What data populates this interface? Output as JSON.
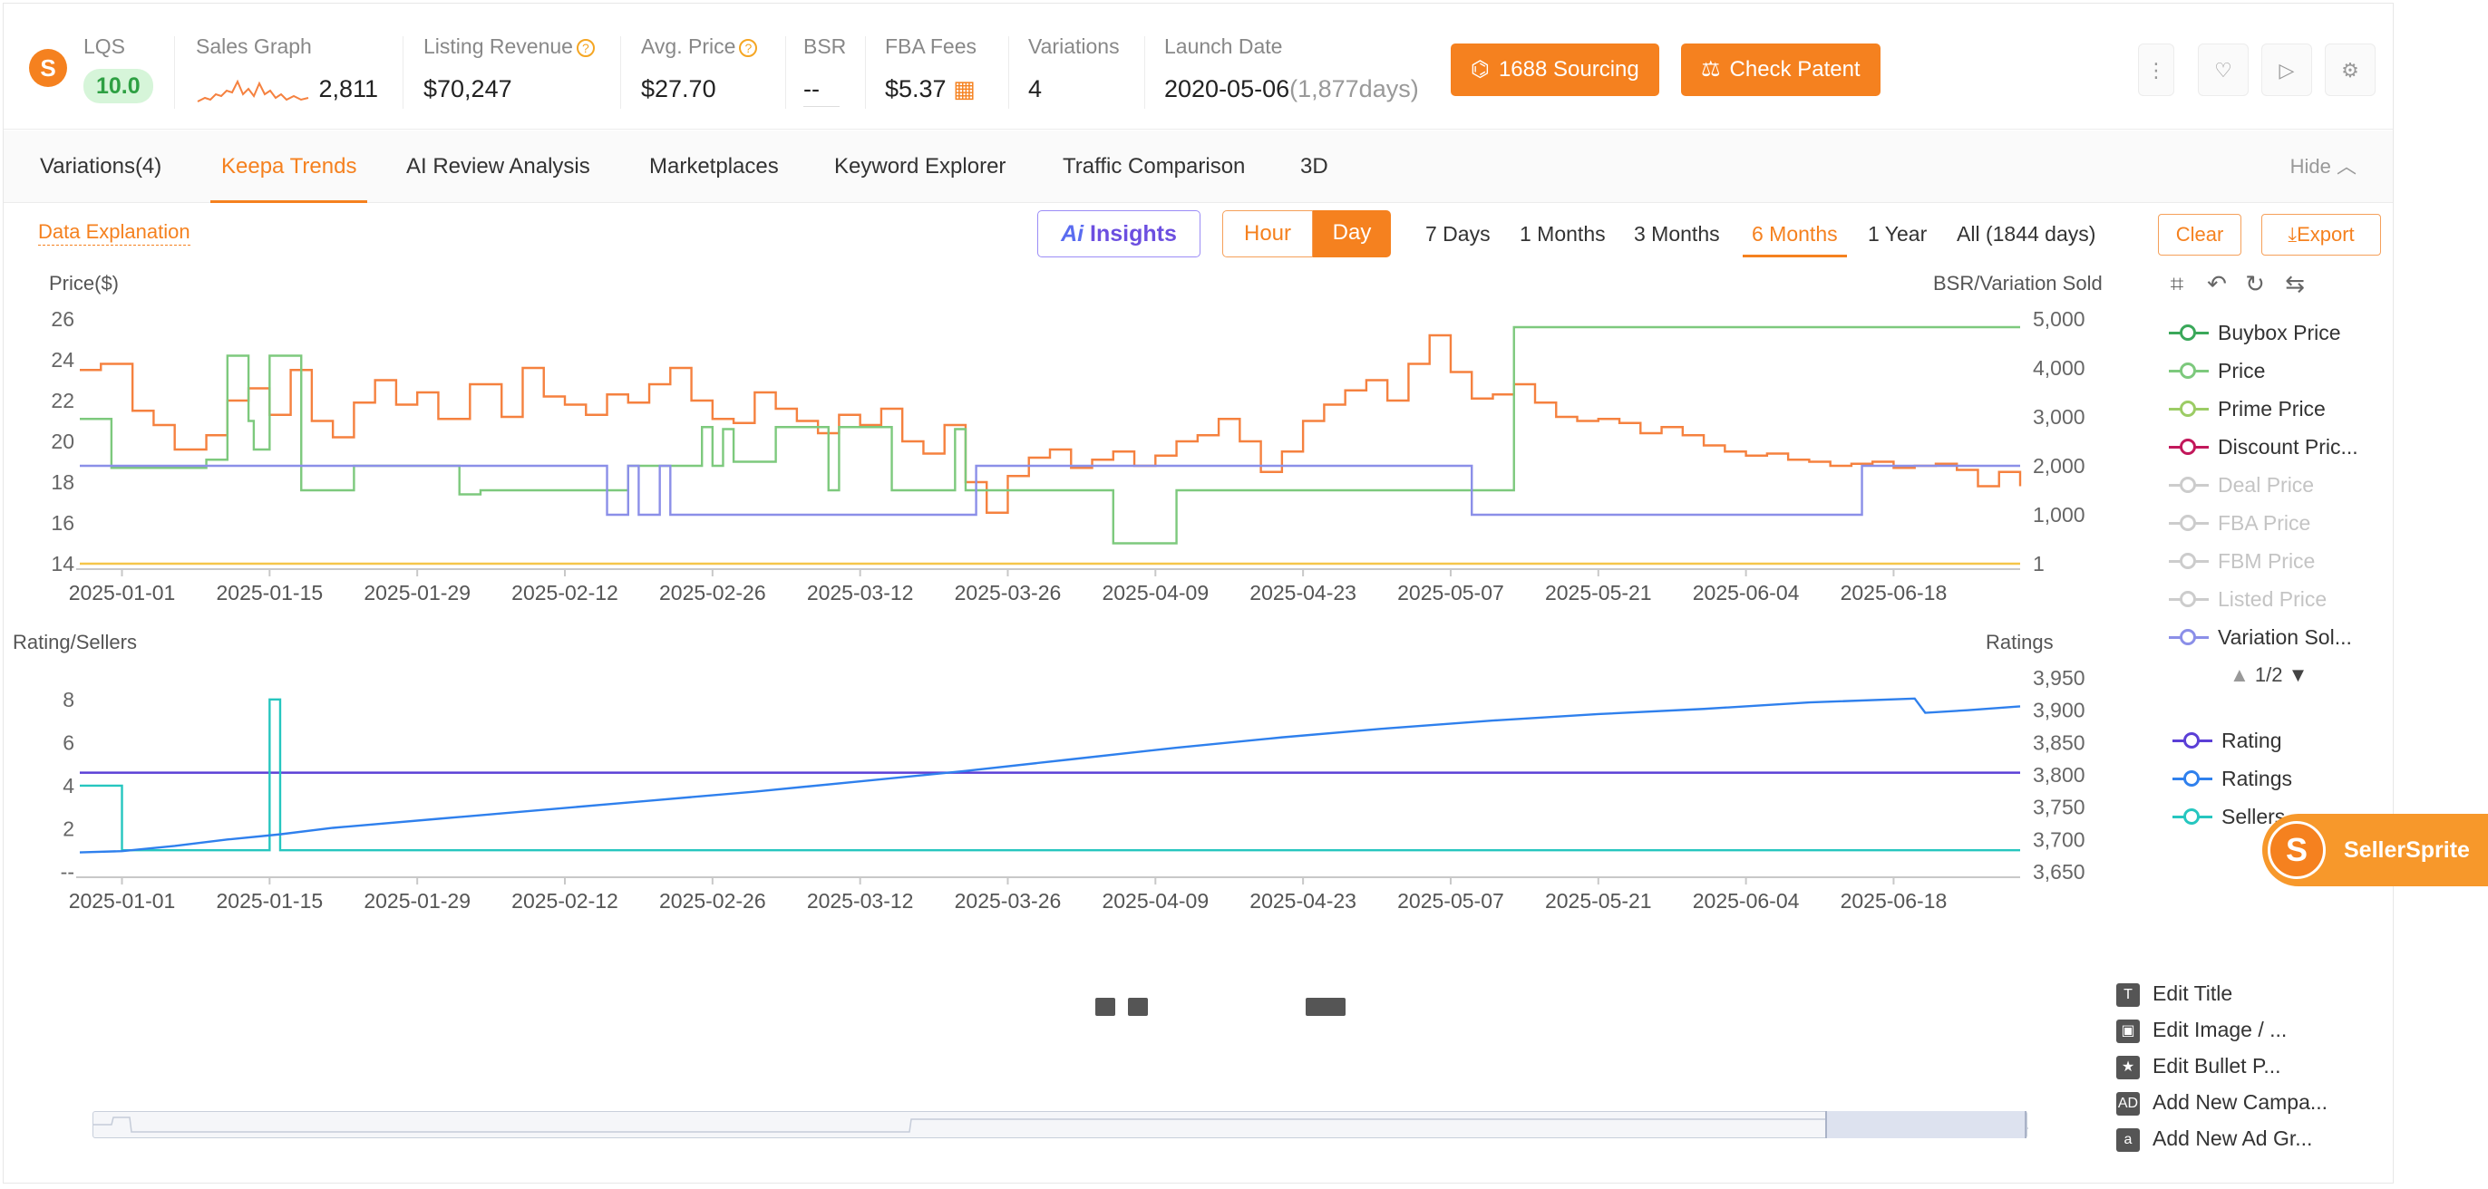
{
  "header": {
    "stats": [
      {
        "label": "LQS",
        "value": "10.0"
      },
      {
        "label": "Sales Graph",
        "value": "2,811"
      },
      {
        "label": "Listing Revenue",
        "value": "$70,247"
      },
      {
        "label": "Avg. Price",
        "value": "$27.70"
      },
      {
        "label": "BSR",
        "value": "--"
      },
      {
        "label": "FBA Fees",
        "value": "$5.37"
      },
      {
        "label": "Variations",
        "value": "4"
      },
      {
        "label": "Launch Date",
        "value": "2020-05-06",
        "extra": "(1,877days)"
      }
    ],
    "sourcing_label": "1688 Sourcing",
    "patent_label": "Check Patent",
    "icons": [
      "more-icon",
      "heart-icon",
      "video-icon",
      "settings-icon"
    ]
  },
  "tabs": [
    "Variations(4)",
    "Keepa Trends",
    "AI Review Analysis",
    "Marketplaces",
    "Keyword Explorer",
    "Traffic Comparison",
    "3D"
  ],
  "active_tab": "Keepa Trends",
  "hide_label": "Hide",
  "toolbar": {
    "data_explanation": "Data Explanation",
    "ai_insights": "Insights",
    "ai_prefix": "Ai",
    "hour": "Hour",
    "day": "Day",
    "ranges": [
      "7 Days",
      "1 Months",
      "3 Months",
      "6 Months",
      "1 Year",
      "All (1844 days)"
    ],
    "active_range": "6 Months",
    "clear": "Clear",
    "export": "Export"
  },
  "legend_top": [
    {
      "name": "Buybox Price",
      "color": "#3aa85a",
      "enabled": true
    },
    {
      "name": "Price",
      "color": "#7dc97d",
      "enabled": true
    },
    {
      "name": "Prime Price",
      "color": "#9ccc65",
      "enabled": true
    },
    {
      "name": "Discount Pric...",
      "color": "#c2185b",
      "enabled": true
    },
    {
      "name": "Deal Price",
      "color": "#cccccc",
      "enabled": false
    },
    {
      "name": "FBA Price",
      "color": "#cccccc",
      "enabled": false
    },
    {
      "name": "FBM Price",
      "color": "#cccccc",
      "enabled": false
    },
    {
      "name": "Listed Price",
      "color": "#cccccc",
      "enabled": false
    },
    {
      "name": "Variation Sol...",
      "color": "#8b8fe8",
      "enabled": true
    }
  ],
  "legend_pager": "1/2",
  "legend_bottom": [
    {
      "name": "Rating",
      "color": "#5b3fd6"
    },
    {
      "name": "Ratings",
      "color": "#2f80ed"
    },
    {
      "name": "Sellers",
      "color": "#26c6bf"
    }
  ],
  "actions": [
    "Edit Title",
    "Edit Image / ...",
    "Edit Bullet P...",
    "Add New Campa...",
    "Add New Ad Gr..."
  ],
  "brand": "SellerSprite",
  "chart_data": [
    {
      "type": "line",
      "ylabel": "Price($)",
      "y2label": "BSR/Variation Sold",
      "yticks": [
        14,
        16,
        18,
        20,
        22,
        24,
        26
      ],
      "y2ticks": [
        "1",
        "1,000",
        "2,000",
        "3,000",
        "4,000",
        "5,000"
      ],
      "xticks": [
        "2025-01-01",
        "2025-01-15",
        "2025-01-29",
        "2025-02-12",
        "2025-02-26",
        "2025-03-12",
        "2025-03-26",
        "2025-04-09",
        "2025-04-23",
        "2025-05-07",
        "2025-05-21",
        "2025-06-04",
        "2025-06-18"
      ],
      "ylim": [
        14,
        26
      ],
      "y2lim": [
        1,
        5000
      ],
      "series": [
        {
          "name": "Buybox Price",
          "color": "#f5813f",
          "axis": "left",
          "x": [
            -4,
            -2,
            1,
            3,
            5,
            8,
            10,
            12,
            14,
            16,
            18,
            20,
            22,
            24,
            26,
            28,
            30,
            33,
            36,
            38,
            40,
            42,
            44,
            46,
            48,
            50,
            52,
            54,
            56,
            58,
            60,
            62,
            64,
            66,
            68,
            70,
            72,
            74,
            76,
            78,
            80,
            82,
            84,
            86,
            88,
            90,
            92,
            94,
            96,
            98,
            100,
            102,
            104,
            106,
            108,
            110,
            112,
            114,
            116,
            118,
            120,
            122,
            124,
            126,
            128,
            130,
            132,
            134,
            136,
            138,
            140,
            142,
            144,
            146,
            148,
            150,
            152,
            154,
            156,
            158,
            160,
            162,
            164,
            166,
            168,
            170,
            172,
            174,
            176,
            178,
            180
          ],
          "y": [
            23.5,
            23.8,
            21.5,
            20.8,
            19.6,
            20.3,
            22.0,
            22.6,
            21.3,
            23.5,
            21.0,
            20.2,
            21.9,
            23.0,
            21.8,
            22.4,
            21.1,
            22.8,
            21.2,
            23.6,
            22.2,
            21.8,
            21.3,
            22.3,
            21.9,
            22.8,
            23.6,
            22.0,
            21.1,
            20.9,
            22.4,
            21.6,
            21.0,
            20.4,
            21.3,
            20.8,
            21.6,
            20.0,
            19.4,
            20.8,
            18.0,
            16.5,
            18.3,
            19.2,
            19.6,
            18.7,
            19.1,
            19.5,
            18.8,
            19.3,
            20.0,
            20.3,
            21.1,
            20.0,
            18.5,
            19.5,
            21.0,
            21.8,
            22.5,
            23.0,
            22.0,
            23.8,
            25.2,
            23.4,
            22.1,
            22.3,
            22.8,
            21.9,
            21.2,
            21.0,
            21.1,
            20.9,
            20.4,
            20.7,
            20.3,
            19.8,
            19.5,
            19.3,
            19.4,
            19.1,
            19.0,
            18.8,
            18.9,
            19.0,
            18.7,
            18.8,
            18.9,
            18.6,
            17.8,
            18.5,
            17.8
          ]
        },
        {
          "name": "Price",
          "color": "#7dc97d",
          "axis": "left",
          "x": [
            -4,
            -2,
            -1,
            8,
            10,
            10.5,
            12,
            12.5,
            14,
            17,
            22,
            32,
            34,
            48,
            55,
            56,
            57,
            58,
            62,
            67,
            68,
            73,
            79,
            80,
            84,
            85,
            94,
            95,
            100,
            101,
            132,
            180
          ],
          "y": [
            21.1,
            21.1,
            18.7,
            19.1,
            24.2,
            24.2,
            21.0,
            19.6,
            24.2,
            17.6,
            18.8,
            17.4,
            17.6,
            18.8,
            20.7,
            18.8,
            20.6,
            19.0,
            20.7,
            17.6,
            20.7,
            17.6,
            20.6,
            17.6,
            17.6,
            17.6,
            15.0,
            15.0,
            17.6,
            17.6,
            25.6,
            25.6
          ]
        },
        {
          "name": "Variation Sold",
          "color": "#8b8fe8",
          "axis": "left",
          "x": [
            -4,
            45,
            46,
            47,
            48,
            49,
            50,
            51,
            52,
            80,
            81,
            127,
            128,
            164,
            165,
            180
          ],
          "y": [
            18.8,
            18.8,
            16.4,
            16.4,
            18.8,
            16.4,
            16.4,
            18.8,
            16.4,
            16.4,
            18.8,
            18.8,
            16.4,
            16.4,
            18.8,
            18.8
          ],
          "vals_on_right_axis": "1,000 to 2,000"
        },
        {
          "name": "Discount Price",
          "color": "#f5c54a",
          "axis": "left",
          "x": [
            -4,
            180
          ],
          "y": [
            14,
            14
          ]
        }
      ]
    },
    {
      "type": "line",
      "ylabel": "Rating/Sellers",
      "y2label": "Ratings",
      "yticks": [
        "--",
        "2",
        "4",
        "6",
        "8"
      ],
      "y2ticks": [
        "3,650",
        "3,700",
        "3,750",
        "3,800",
        "3,850",
        "3,900",
        "3,950"
      ],
      "xticks": [
        "2025-01-01",
        "2025-01-15",
        "2025-01-29",
        "2025-02-12",
        "2025-02-26",
        "2025-03-12",
        "2025-03-26",
        "2025-04-09",
        "2025-04-23",
        "2025-05-07",
        "2025-05-21",
        "2025-06-04",
        "2025-06-18"
      ],
      "ylim": [
        0,
        9
      ],
      "y2lim": [
        3650,
        3950
      ],
      "series": [
        {
          "name": "Rating",
          "color": "#5b3fd6",
          "axis": "left",
          "x": [
            -4,
            180
          ],
          "y": [
            4.6,
            4.6
          ]
        },
        {
          "name": "Sellers",
          "color": "#26c6bf",
          "axis": "left",
          "x": [
            -4,
            0,
            0,
            14,
            14,
            15,
            15,
            180
          ],
          "y": [
            4,
            4,
            1,
            1,
            8,
            8,
            1,
            1
          ]
        },
        {
          "name": "Ratings",
          "color": "#2f80ed",
          "axis": "right",
          "x": [
            -4,
            0,
            5,
            10,
            15,
            20,
            30,
            40,
            50,
            60,
            70,
            80,
            90,
            100,
            110,
            120,
            130,
            140,
            150,
            160,
            170,
            171,
            175,
            180
          ],
          "y": [
            3680,
            3682,
            3690,
            3700,
            3708,
            3718,
            3732,
            3746,
            3760,
            3774,
            3790,
            3806,
            3824,
            3842,
            3858,
            3872,
            3884,
            3894,
            3902,
            3912,
            3918,
            3896,
            3900,
            3906
          ]
        }
      ]
    }
  ]
}
